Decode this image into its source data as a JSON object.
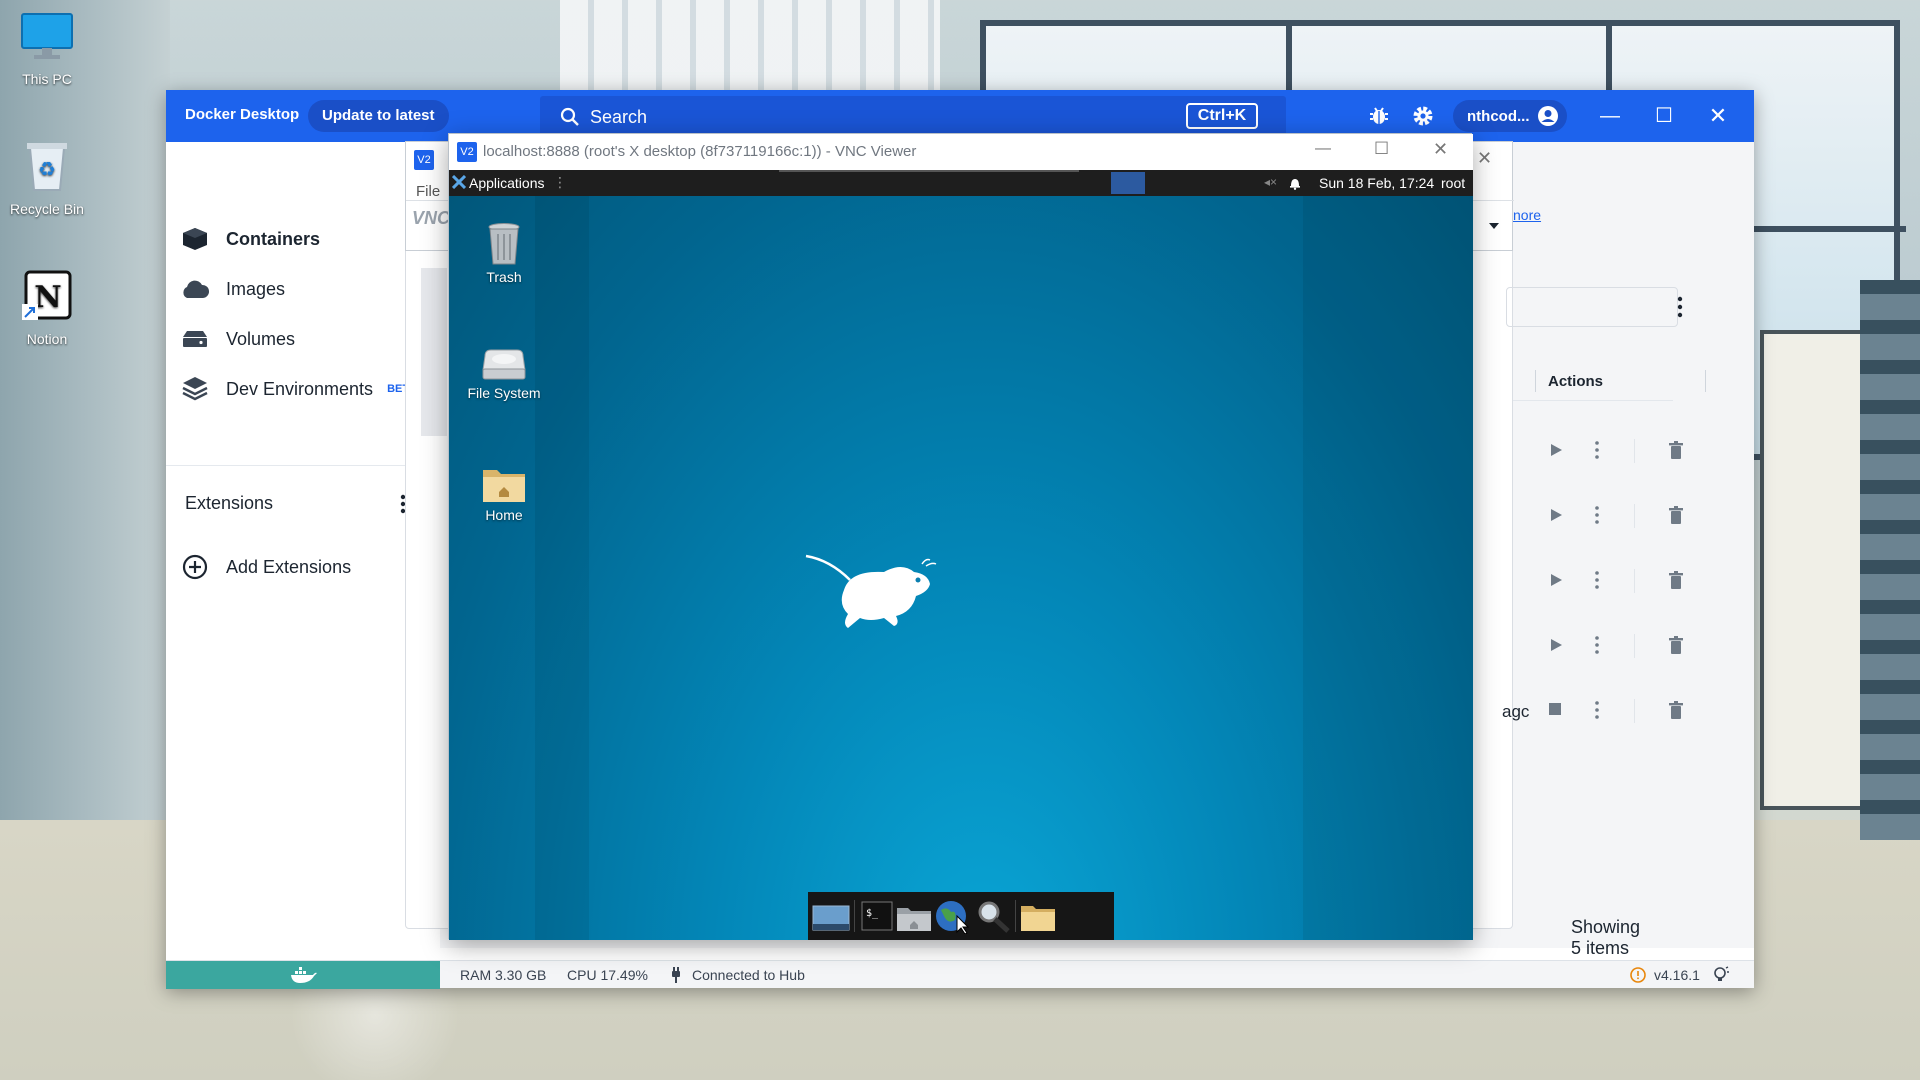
{
  "desktop": {
    "icons": [
      {
        "label": "This PC"
      },
      {
        "label": "Recycle Bin"
      },
      {
        "label": "Notion"
      }
    ]
  },
  "docker": {
    "brand": "Docker Desktop",
    "update_button": "Update to latest",
    "search_label": "Search",
    "search_shortcut": "Ctrl+K",
    "account_name": "nthcod...",
    "nav": [
      {
        "label": "Containers",
        "icon": "containers-icon"
      },
      {
        "label": "Images",
        "icon": "images-icon"
      },
      {
        "label": "Volumes",
        "icon": "volumes-icon"
      },
      {
        "label": "Dev Environments",
        "icon": "dev-environments-icon",
        "badge": "BET"
      }
    ],
    "extensions_label": "Extensions",
    "add_extensions_label": "Add Extensions",
    "learn_more_fragment": "nore",
    "table_header_actions": "Actions",
    "row_name_fragment": "agc",
    "showing_items": "Showing 5 items",
    "status": {
      "ram": "RAM 3.30 GB",
      "cpu": "CPU 17.49%",
      "hub": "Connected to Hub",
      "version": "v4.16.1"
    },
    "accent_color": "#1d63ed",
    "status_whale_color": "#3ba79f"
  },
  "vnc_background_window": {
    "menu_file": "File",
    "logo_fragment": "VNC"
  },
  "vnc": {
    "title": "localhost:8888 (root's X desktop (8f737119166c:1)) - VNC Viewer",
    "panel": {
      "applications": "Applications",
      "datetime": "Sun 18 Feb, 17:24",
      "user": "root"
    },
    "desktop_icons": [
      {
        "label": "Trash",
        "icon": "trash-icon"
      },
      {
        "label": "File System",
        "icon": "file-system-icon"
      },
      {
        "label": "Home",
        "icon": "home-folder-icon"
      }
    ]
  }
}
